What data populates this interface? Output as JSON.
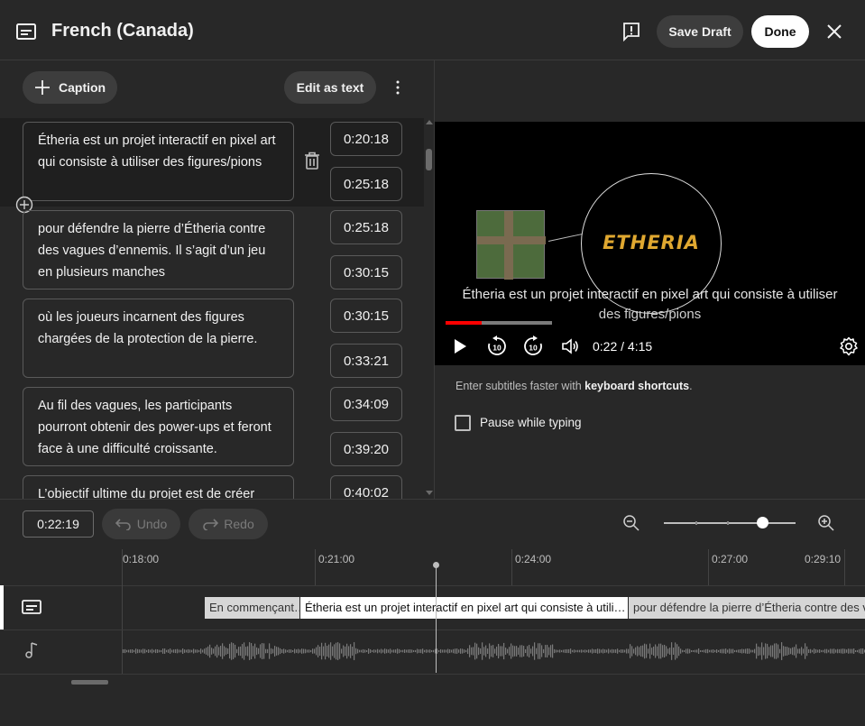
{
  "header": {
    "title": "French (Canada)",
    "save_label": "Save Draft",
    "done_label": "Done"
  },
  "toolbar": {
    "caption_label": "Caption",
    "edit_label": "Edit as text"
  },
  "captions": [
    {
      "text": "Étheria est un projet interactif en pixel art qui consiste à utiliser des figures/pions",
      "start": "0:20:18",
      "end": "0:25:18"
    },
    {
      "text": "pour défendre la pierre d’Étheria contre des vagues d’ennemis. Il s’agit d’un jeu en plusieurs manches",
      "start": "0:25:18",
      "end": "0:30:15"
    },
    {
      "text": "où les joueurs incarnent des figures chargées de la protection de la pierre.",
      "start": "0:30:15",
      "end": "0:33:21"
    },
    {
      "text": "Au fil des vagues, les participants pourront obtenir des power-ups et feront face à une difficulté croissante.",
      "start": "0:34:09",
      "end": "0:39:20"
    },
    {
      "text": "L’objectif ultime du projet est de créer",
      "start": "0:40:02",
      "end": ""
    }
  ],
  "player": {
    "logo_text": "ETHERIA",
    "subtitle_line1": "Étheria est un projet interactif en pixel art qui consiste à utiliser",
    "subtitle_line2": "des figures/pions",
    "time": "0:22 / 4:15",
    "progress": 0.34
  },
  "options": {
    "hint_prefix": "Enter subtitles faster with ",
    "hint_link": "keyboard shortcuts",
    "hint_suffix": ".",
    "pause_label": "Pause while typing"
  },
  "timeline": {
    "current_time": "0:22:19",
    "undo_label": "Undo",
    "redo_label": "Redo",
    "ruler": [
      "0:18:00",
      "0:21:00",
      "0:24:00",
      "0:27:00",
      "0:29:10"
    ],
    "segments": [
      "En commençant…",
      "Étheria est un projet interactif en pixel art qui consiste à utili…",
      "pour défendre la pierre d’Étheria contre des vagues"
    ]
  },
  "colors": {
    "accent": "#ff0000",
    "background": "#282828"
  }
}
